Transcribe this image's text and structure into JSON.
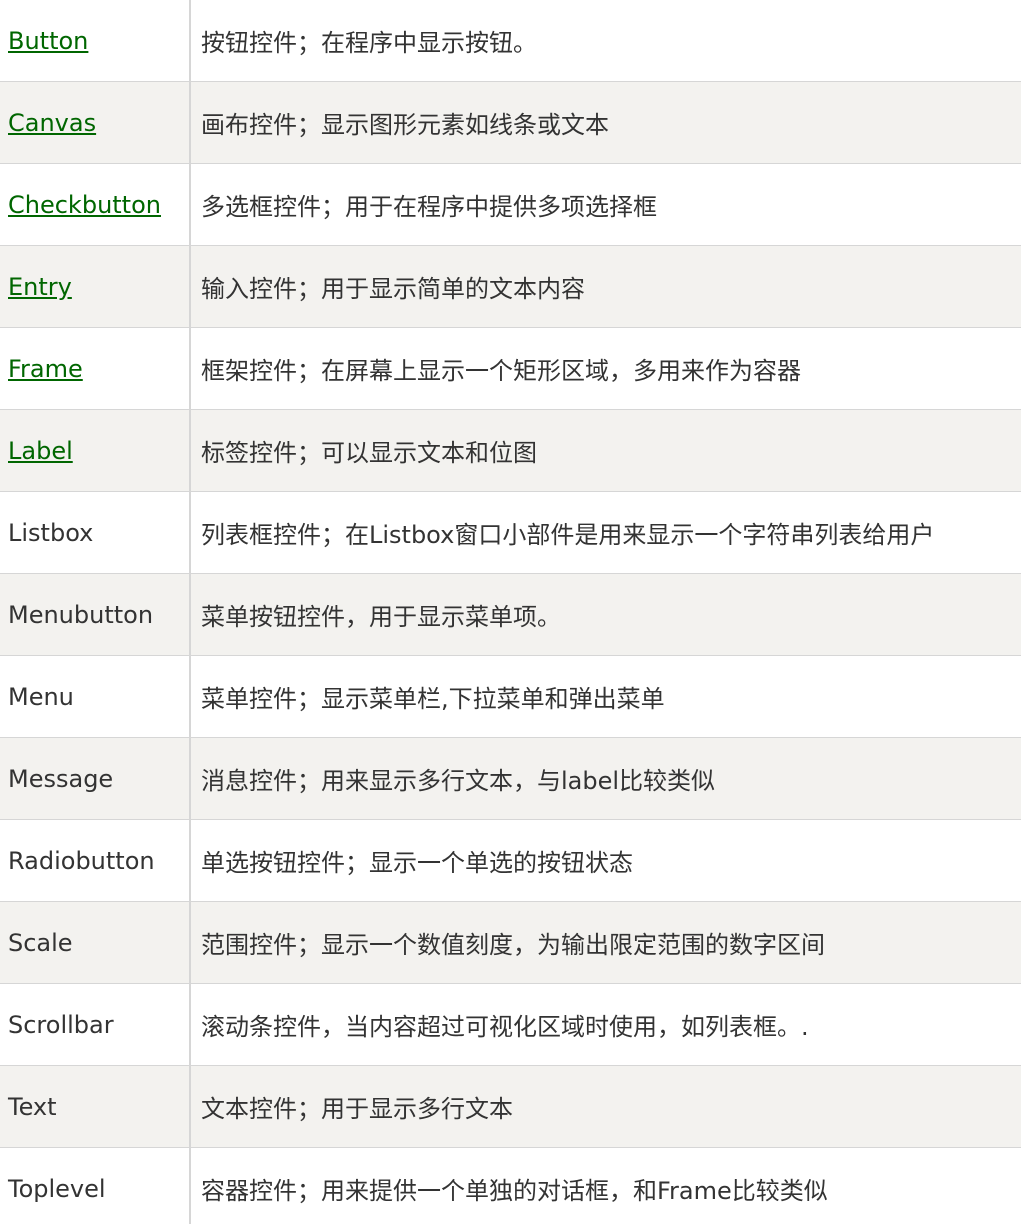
{
  "colors": {
    "link": "#006600",
    "text": "#333333",
    "stripe": "#f3f2ef",
    "border": "#d6d6d6"
  },
  "rows": [
    {
      "name": "Button",
      "desc": "按钮控件；在程序中显示按钮。",
      "link": true
    },
    {
      "name": "Canvas",
      "desc": "画布控件；显示图形元素如线条或文本",
      "link": true
    },
    {
      "name": "Checkbutton",
      "desc": "多选框控件；用于在程序中提供多项选择框",
      "link": true
    },
    {
      "name": "Entry",
      "desc": "输入控件；用于显示简单的文本内容",
      "link": true
    },
    {
      "name": "Frame",
      "desc": "框架控件；在屏幕上显示一个矩形区域，多用来作为容器",
      "link": true
    },
    {
      "name": "Label",
      "desc": "标签控件；可以显示文本和位图",
      "link": true
    },
    {
      "name": "Listbox",
      "desc": "列表框控件；在Listbox窗口小部件是用来显示一个字符串列表给用户",
      "link": false
    },
    {
      "name": "Menubutton",
      "desc": "菜单按钮控件，用于显示菜单项。",
      "link": false
    },
    {
      "name": "Menu",
      "desc": "菜单控件；显示菜单栏,下拉菜单和弹出菜单",
      "link": false
    },
    {
      "name": "Message",
      "desc": "消息控件；用来显示多行文本，与label比较类似",
      "link": false
    },
    {
      "name": "Radiobutton",
      "desc": "单选按钮控件；显示一个单选的按钮状态",
      "link": false
    },
    {
      "name": "Scale",
      "desc": "范围控件；显示一个数值刻度，为输出限定范围的数字区间",
      "link": false
    },
    {
      "name": "Scrollbar",
      "desc": "滚动条控件，当内容超过可视化区域时使用，如列表框。.",
      "link": false
    },
    {
      "name": "Text",
      "desc": "文本控件；用于显示多行文本",
      "link": false
    },
    {
      "name": "Toplevel",
      "desc": "容器控件；用来提供一个单独的对话框，和Frame比较类似",
      "link": false
    }
  ]
}
